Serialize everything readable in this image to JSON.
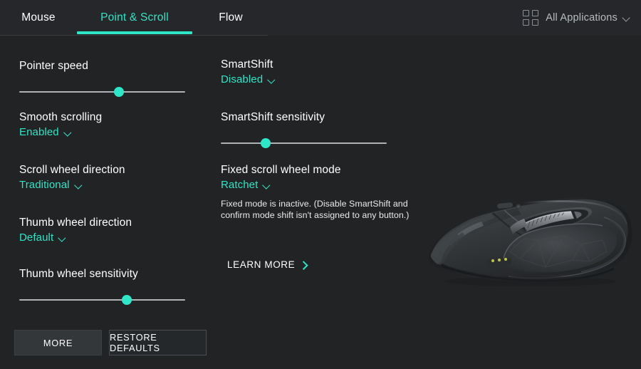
{
  "header": {
    "tabs": [
      {
        "label": "Mouse",
        "active": false
      },
      {
        "label": "Point & Scroll",
        "active": true
      },
      {
        "label": "Flow",
        "active": false
      }
    ],
    "app_selector": {
      "icon": "grid-icon",
      "label": "All Applications",
      "chevron": "chevron-down-icon"
    }
  },
  "left_column": [
    {
      "id": "pointer-speed",
      "title": "Pointer speed",
      "control": "slider",
      "value_pct": 60
    },
    {
      "id": "smooth-scrolling",
      "title": "Smooth scrolling",
      "control": "dropdown",
      "value": "Enabled"
    },
    {
      "id": "scroll-wheel-direction",
      "title": "Scroll wheel direction",
      "control": "dropdown",
      "value": "Traditional"
    },
    {
      "id": "thumb-wheel-direction",
      "title": "Thumb wheel direction",
      "control": "dropdown",
      "value": "Default"
    },
    {
      "id": "thumb-wheel-sensitivity",
      "title": "Thumb wheel sensitivity",
      "control": "slider",
      "value_pct": 65
    }
  ],
  "right_column": [
    {
      "id": "smartshift",
      "title": "SmartShift",
      "control": "dropdown",
      "value": "Disabled"
    },
    {
      "id": "smartshift-sensitivity",
      "title": "SmartShift sensitivity",
      "control": "slider",
      "value_pct": 27
    },
    {
      "id": "fixed-scroll-wheel-mode",
      "title": "Fixed scroll wheel mode",
      "control": "dropdown",
      "value": "Ratchet"
    }
  ],
  "helper_text": "Fixed mode is inactive. (Disable SmartShift and confirm mode shift isn't assigned to any button.)",
  "learn_more": {
    "label": "LEARN MORE",
    "icon": "chevron-right-icon"
  },
  "footer": {
    "more_label": "MORE",
    "restore_label": "RESTORE DEFAULTS"
  },
  "device_image": {
    "name": "logitech-mx-master-mouse"
  },
  "colors": {
    "accent": "#2ee6c8",
    "header_bg": "#25272a",
    "body_bg": "#212325",
    "text": "#ffffff",
    "muted_text": "#b9bcbf",
    "slider_track": "#b0b3b6"
  }
}
